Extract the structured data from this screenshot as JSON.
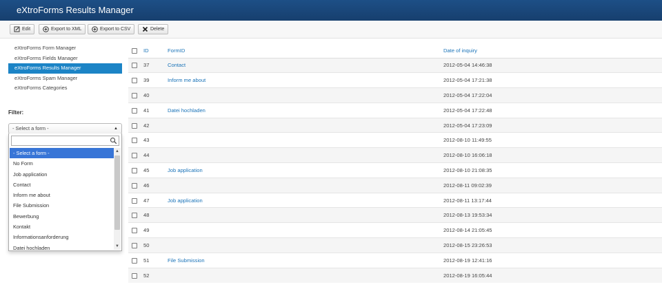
{
  "app": {
    "title": "eXtroForms Results Manager"
  },
  "toolbar": {
    "edit": "Edit",
    "export_xml": "Export to XML",
    "export_csv": "Export to CSV",
    "delete": "Delete"
  },
  "sidebar": {
    "items": [
      {
        "label": "eXtroForms Form Manager"
      },
      {
        "label": "eXtroForms Fields Manager"
      },
      {
        "label": "eXtroForms Results Manager",
        "active": true
      },
      {
        "label": "eXtroForms Spam Manager"
      },
      {
        "label": "eXtroForms Categories"
      }
    ]
  },
  "filter": {
    "label": "Filter:",
    "selected": "- Select a form -",
    "search_value": "",
    "options": [
      "- Select a form -",
      "No Form",
      "Job application",
      "Contact",
      "Inform me about",
      "File Submission",
      "Bewerbung",
      "Kontakt",
      "Informationsanforderung",
      "Datei hochladen"
    ]
  },
  "table": {
    "headers": {
      "id": "ID",
      "form": "FormID",
      "date": "Date of inquiry"
    },
    "rows": [
      {
        "id": "37",
        "form": "Contact",
        "date": "2012-05-04 14:46:38"
      },
      {
        "id": "39",
        "form": "Inform me about",
        "date": "2012-05-04 17:21:38"
      },
      {
        "id": "40",
        "form": "",
        "date": "2012-05-04 17:22:04"
      },
      {
        "id": "41",
        "form": "Datei hochladen",
        "date": "2012-05-04 17:22:48"
      },
      {
        "id": "42",
        "form": "",
        "date": "2012-05-04 17:23:09"
      },
      {
        "id": "43",
        "form": "",
        "date": "2012-08-10 11:49:55"
      },
      {
        "id": "44",
        "form": "",
        "date": "2012-08-10 16:06:18"
      },
      {
        "id": "45",
        "form": "Job application",
        "date": "2012-08-10 21:08:35"
      },
      {
        "id": "46",
        "form": "",
        "date": "2012-08-11 09:02:39"
      },
      {
        "id": "47",
        "form": "Job application",
        "date": "2012-08-11 13:17:44"
      },
      {
        "id": "48",
        "form": "",
        "date": "2012-08-13 19:53:34"
      },
      {
        "id": "49",
        "form": "",
        "date": "2012-08-14 21:05:45"
      },
      {
        "id": "50",
        "form": "",
        "date": "2012-08-15 23:26:53"
      },
      {
        "id": "51",
        "form": "File Submission",
        "date": "2012-08-19 12:41:16"
      },
      {
        "id": "52",
        "form": "",
        "date": "2012-08-19 16:05:44"
      }
    ]
  },
  "colors": {
    "header_bg": "#1d4f86",
    "accent": "#1c84c6",
    "link": "#1a73b8",
    "selected_option": "#3875d7"
  },
  "icons": {
    "edit": "edit-icon",
    "export_xml": "plus-circle-icon",
    "export_csv": "plus-circle-icon",
    "delete": "x-icon",
    "search": "search-icon",
    "select_arrow": "triangle-down-icon"
  }
}
